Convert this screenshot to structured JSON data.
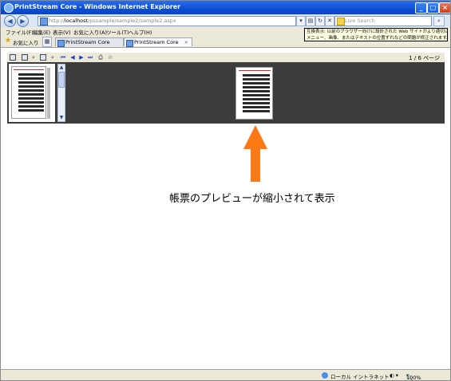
{
  "window": {
    "title": "PrintStream Core - Windows Internet Explorer",
    "controls": {
      "minimize": "_",
      "maximize": "□",
      "close": "×"
    }
  },
  "address_bar": {
    "url_prefix": "http://",
    "url_host": "localhost",
    "url_path": "/pssample/sample2/sample2.aspx",
    "search_placeholder": "Live Search",
    "back_glyph": "◀",
    "forward_glyph": "▶"
  },
  "menu": {
    "items": [
      "ファイル(F)",
      "編集(E)",
      "表示(V)",
      "お気に入り(A)",
      "ツール(T)",
      "ヘルプ(H)"
    ]
  },
  "tooltip": {
    "line1": "互換表示: 以前のブラウザー向けに設計された Web サイトがより適切に表示され",
    "line2": "メニュー、画像、またはテキストの位置ずれなどの問題が修正されます。"
  },
  "favorites": {
    "label": "お気に入り",
    "tabs": [
      {
        "label": "PrintStream Core",
        "active": false
      },
      {
        "label": "PrintStream Core",
        "active": true
      }
    ],
    "close_glyph": "×"
  },
  "viewer": {
    "page_indicator": "1 / 6 ページ"
  },
  "annotation": {
    "caption": "帳票のプレビューが縮小されて表示"
  },
  "status": {
    "zone": "ローカル イントラネット",
    "zoom": "100%"
  }
}
